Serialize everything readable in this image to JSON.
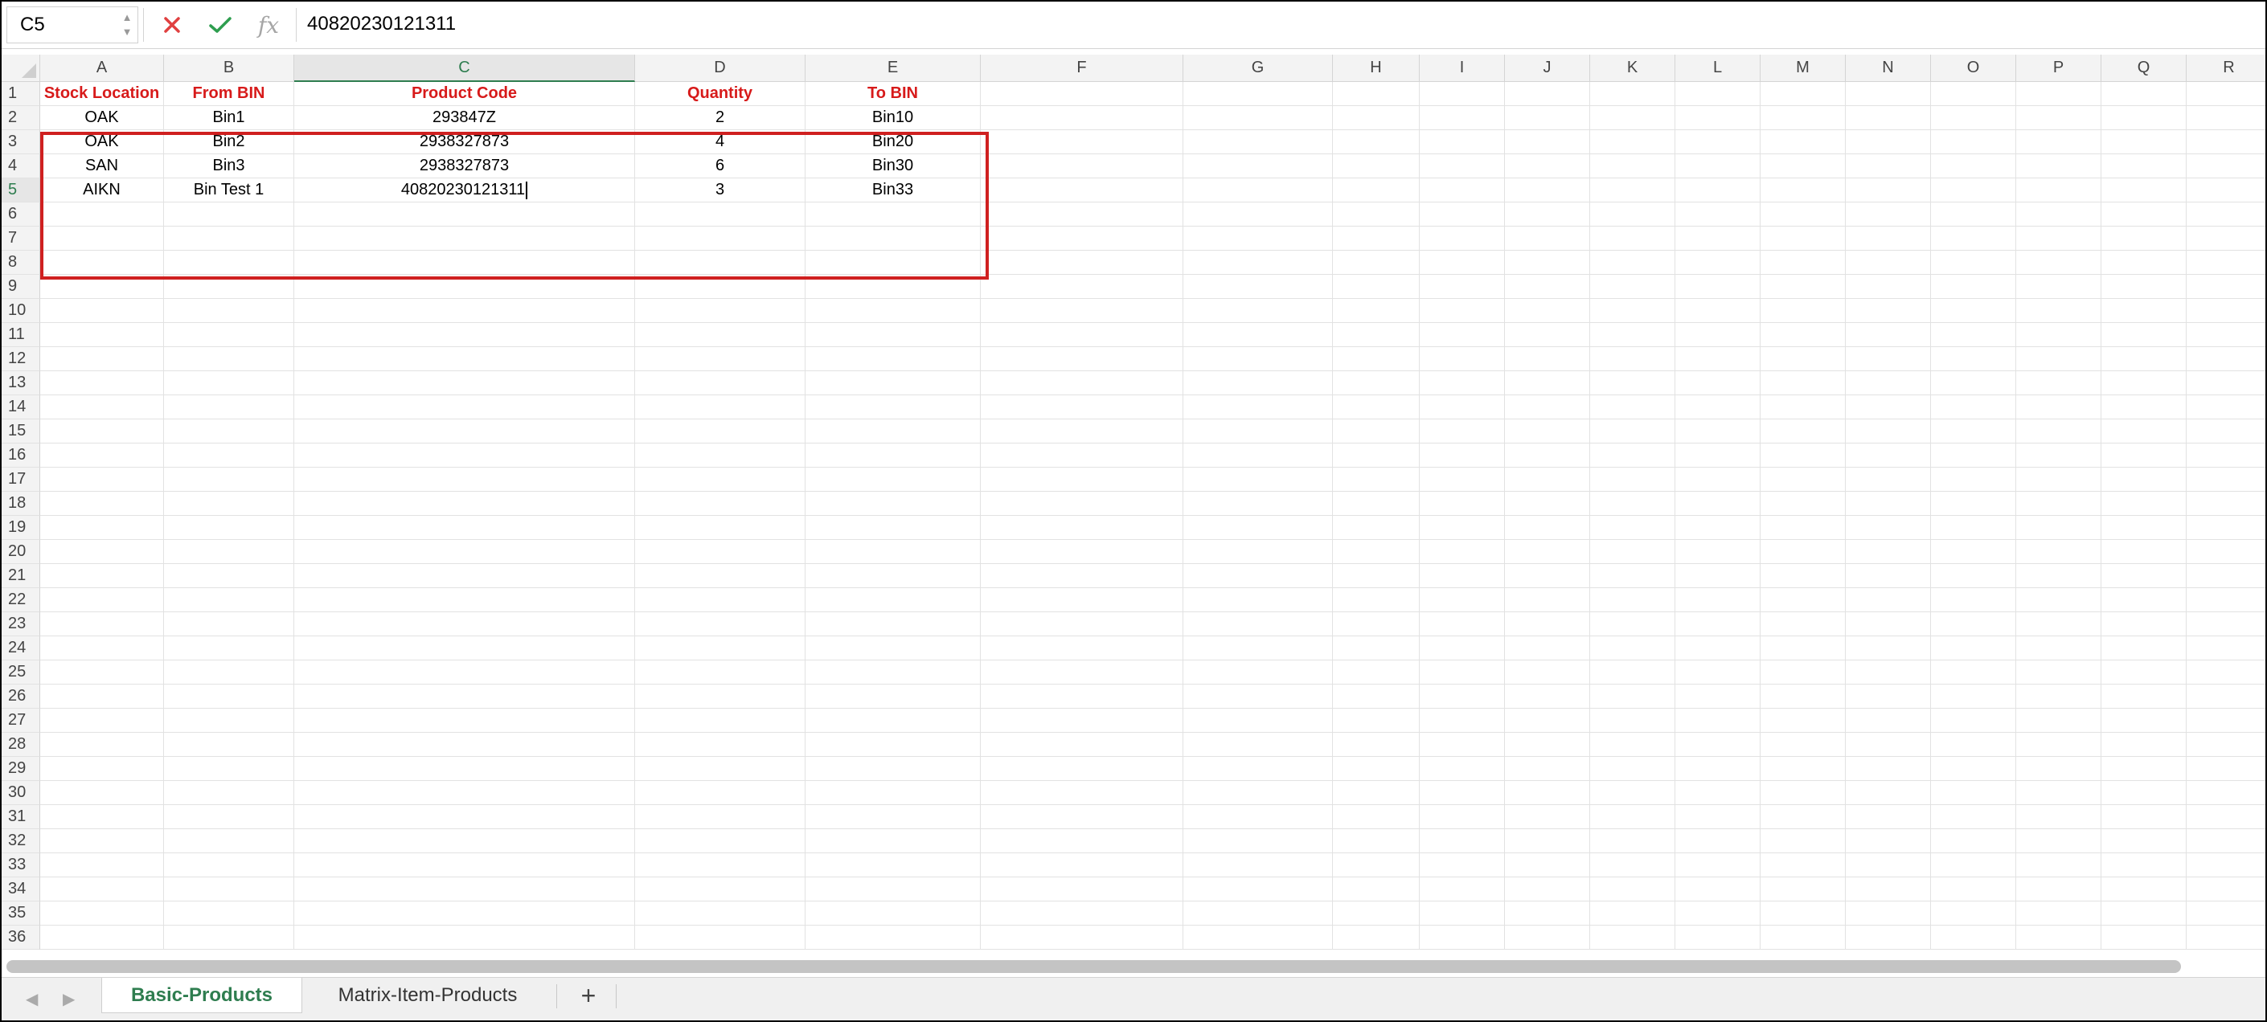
{
  "formula_bar": {
    "cell_ref": "C5",
    "fx_label": "fx",
    "value": "40820230121311"
  },
  "columns": [
    "A",
    "B",
    "C",
    "D",
    "E",
    "F",
    "G",
    "H",
    "I",
    "J",
    "K",
    "L",
    "M",
    "N",
    "O",
    "P",
    "Q",
    "R"
  ],
  "active_column": "C",
  "active_row": 5,
  "rows": [
    "1",
    "2",
    "3",
    "4",
    "5",
    "6",
    "7",
    "8",
    "9",
    "10",
    "11",
    "12",
    "13",
    "14",
    "15",
    "16",
    "17",
    "18",
    "19",
    "20",
    "21",
    "22",
    "23",
    "24",
    "25",
    "26",
    "27",
    "28",
    "29",
    "30",
    "31",
    "32",
    "33",
    "34",
    "35",
    "36"
  ],
  "table": {
    "headers": [
      "Stock Location",
      "From BIN",
      "Product Code",
      "Quantity",
      "To BIN"
    ],
    "rows": [
      [
        "OAK",
        "Bin1",
        "293847Z",
        "2",
        "Bin10"
      ],
      [
        "OAK",
        "Bin2",
        "2938327873",
        "4",
        "Bin20"
      ],
      [
        "SAN",
        "Bin3",
        "2938327873",
        "6",
        "Bin30"
      ],
      [
        "AIKN",
        "Bin Test 1",
        "40820230121311",
        "3",
        "Bin33"
      ]
    ],
    "header_color": "#d71a1a",
    "highlight_color": "#cf2020"
  },
  "sheets": {
    "tabs": [
      "Basic-Products",
      "Matrix-Item-Products"
    ],
    "active": "Basic-Products",
    "add_label": "+"
  },
  "colors": {
    "accent": "#2e7d4f",
    "cancel": "#e04040",
    "confirm": "#2e9e4f"
  }
}
